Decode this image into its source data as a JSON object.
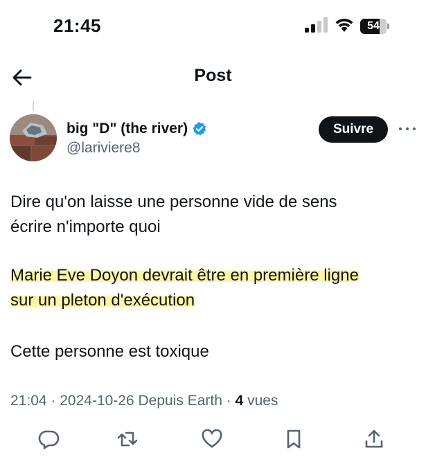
{
  "status_bar": {
    "time": "21:45",
    "battery": "54",
    "icons": [
      "cellular-signal-icon",
      "wifi-icon",
      "battery-icon"
    ]
  },
  "nav": {
    "title": "Post",
    "back_icon": "arrow-left-icon"
  },
  "author": {
    "display_name": "big \"D\" (the river)",
    "handle": "@lariviere8",
    "verified": true,
    "verified_color": "#1d9bf0"
  },
  "follow_label": "Suivre",
  "tweet": {
    "paragraphs": [
      {
        "lines": [
          "Dire qu'on laisse une personne vide de sens",
          "écrire n'importe quoi"
        ],
        "highlighted": false
      },
      {
        "lines": [
          "Marie Eve Doyon devrait être en première ligne",
          "sur un pleton d'exécution"
        ],
        "highlighted": true
      },
      {
        "lines": [
          "Cette personne est toxique"
        ],
        "highlighted": false
      }
    ],
    "highlight_color": "#fff078"
  },
  "meta": {
    "time": "21:04",
    "separator": " · ",
    "date": "2024-10-26",
    "source": "Depuis Earth",
    "views_count": "4",
    "views_label": "vues"
  },
  "actions": [
    "reply-icon",
    "repost-icon",
    "like-icon",
    "bookmark-icon",
    "share-icon"
  ],
  "colors": {
    "text": "#0f1419",
    "secondary": "#536471",
    "button_bg": "#0f1419"
  }
}
